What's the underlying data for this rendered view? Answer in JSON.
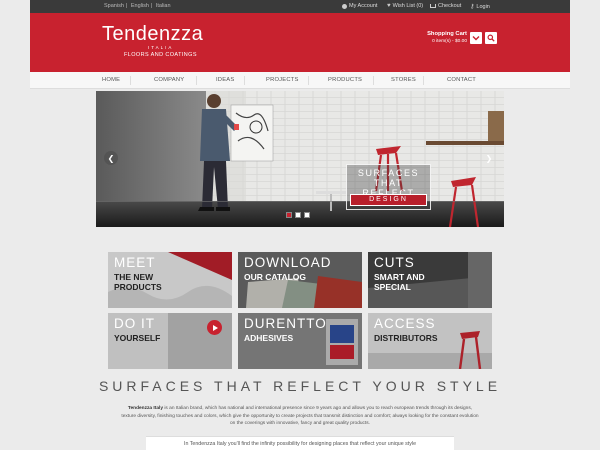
{
  "topbar": {
    "languages": [
      "Spanish",
      "English",
      "Italian"
    ],
    "language_separator": "|",
    "links": [
      {
        "label": "My Account",
        "icon": "user-icon"
      },
      {
        "label": "Wish List (0)",
        "icon": "heart-icon"
      },
      {
        "label": "Checkout",
        "icon": "cart-icon"
      },
      {
        "label": "Login",
        "icon": "key-icon"
      }
    ]
  },
  "header": {
    "brand": "Tendenzza",
    "brand_sub": "ITALIA",
    "tagline": "FLOORS AND COATINGS",
    "cart_title": "Shopping Cart",
    "cart_summary": "0 item(s) - $0.00",
    "cart_icon": "chevron-down-icon",
    "search_icon": "search-icon"
  },
  "nav": {
    "items": [
      "HOME",
      "COMPANY",
      "IDEAS",
      "PROJECTS",
      "PRODUCTS",
      "STORES",
      "CONTACT"
    ]
  },
  "hero": {
    "tagline_line1": "SURFACES",
    "tagline_line2": "THAT REFLECT",
    "tagline_line3": "DESIGN",
    "prev_icon": "chevron-left-icon",
    "next_icon": "chevron-right-icon",
    "slides": 3,
    "active_slide": 1
  },
  "tiles": [
    {
      "big": "MEET",
      "sub1": "THE NEW",
      "sub2": "PRODUCTS"
    },
    {
      "big": "DOWNLOAD",
      "sub1": "OUR CATALOG",
      "sub2": ""
    },
    {
      "big": "CUTS",
      "sub1": "SMART AND",
      "sub2": "SPECIAL"
    },
    {
      "big": "DO IT",
      "sub1": "YOURSELF",
      "sub2": "",
      "icon": "play-icon"
    },
    {
      "big": "DURENTTO",
      "sub1": "ADHESIVES",
      "sub2": ""
    },
    {
      "big": "ACCESS",
      "sub1": "DISTRIBUTORS",
      "sub2": ""
    }
  ],
  "main": {
    "slogan": "SURFACES THAT REFLECT YOUR STYLE",
    "intro_brand": "Tendenzza Italy",
    "intro_text": " is an Italian brand, which has national and international presence since 9 years ago and allows you to reach european trends through its designs, texture diversity, finishing touches and colors, which give the opportunity to create projects that transmit distinction and comfort; always looking for the constant evolution on the coverings with innovative, fancy and great quality products.",
    "info_bar": "In Tendenzza Italy you'll find the infinity possibility for designing places that reflect your unique style"
  },
  "colors": {
    "brand_red": "#c8222f",
    "topbar": "#3a3a3a",
    "page_bg": "#ebebeb"
  }
}
